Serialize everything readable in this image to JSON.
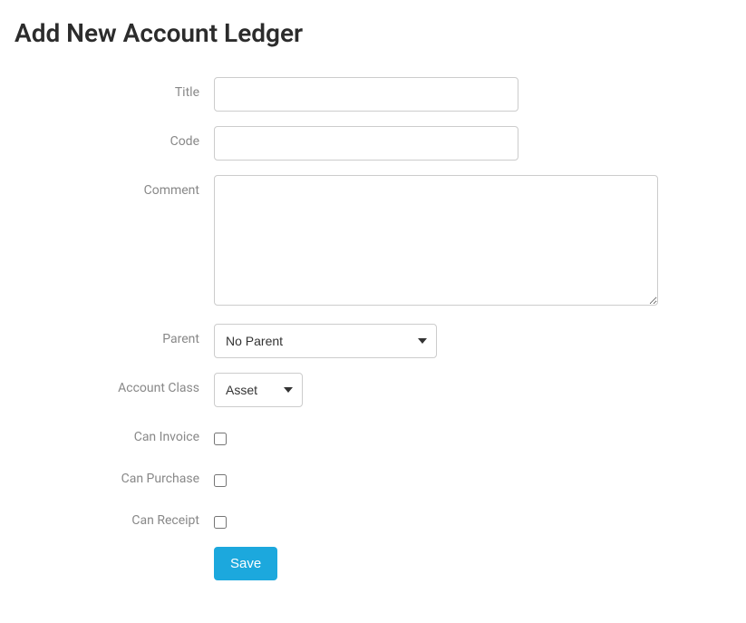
{
  "page": {
    "title": "Add New Account Ledger"
  },
  "form": {
    "title": {
      "label": "Title",
      "value": ""
    },
    "code": {
      "label": "Code",
      "value": ""
    },
    "comment": {
      "label": "Comment",
      "value": ""
    },
    "parent": {
      "label": "Parent",
      "selected": "No Parent"
    },
    "account_class": {
      "label": "Account Class",
      "selected": "Asset"
    },
    "can_invoice": {
      "label": "Can Invoice",
      "checked": false
    },
    "can_purchase": {
      "label": "Can Purchase",
      "checked": false
    },
    "can_receipt": {
      "label": "Can Receipt",
      "checked": false
    },
    "save_label": "Save"
  }
}
